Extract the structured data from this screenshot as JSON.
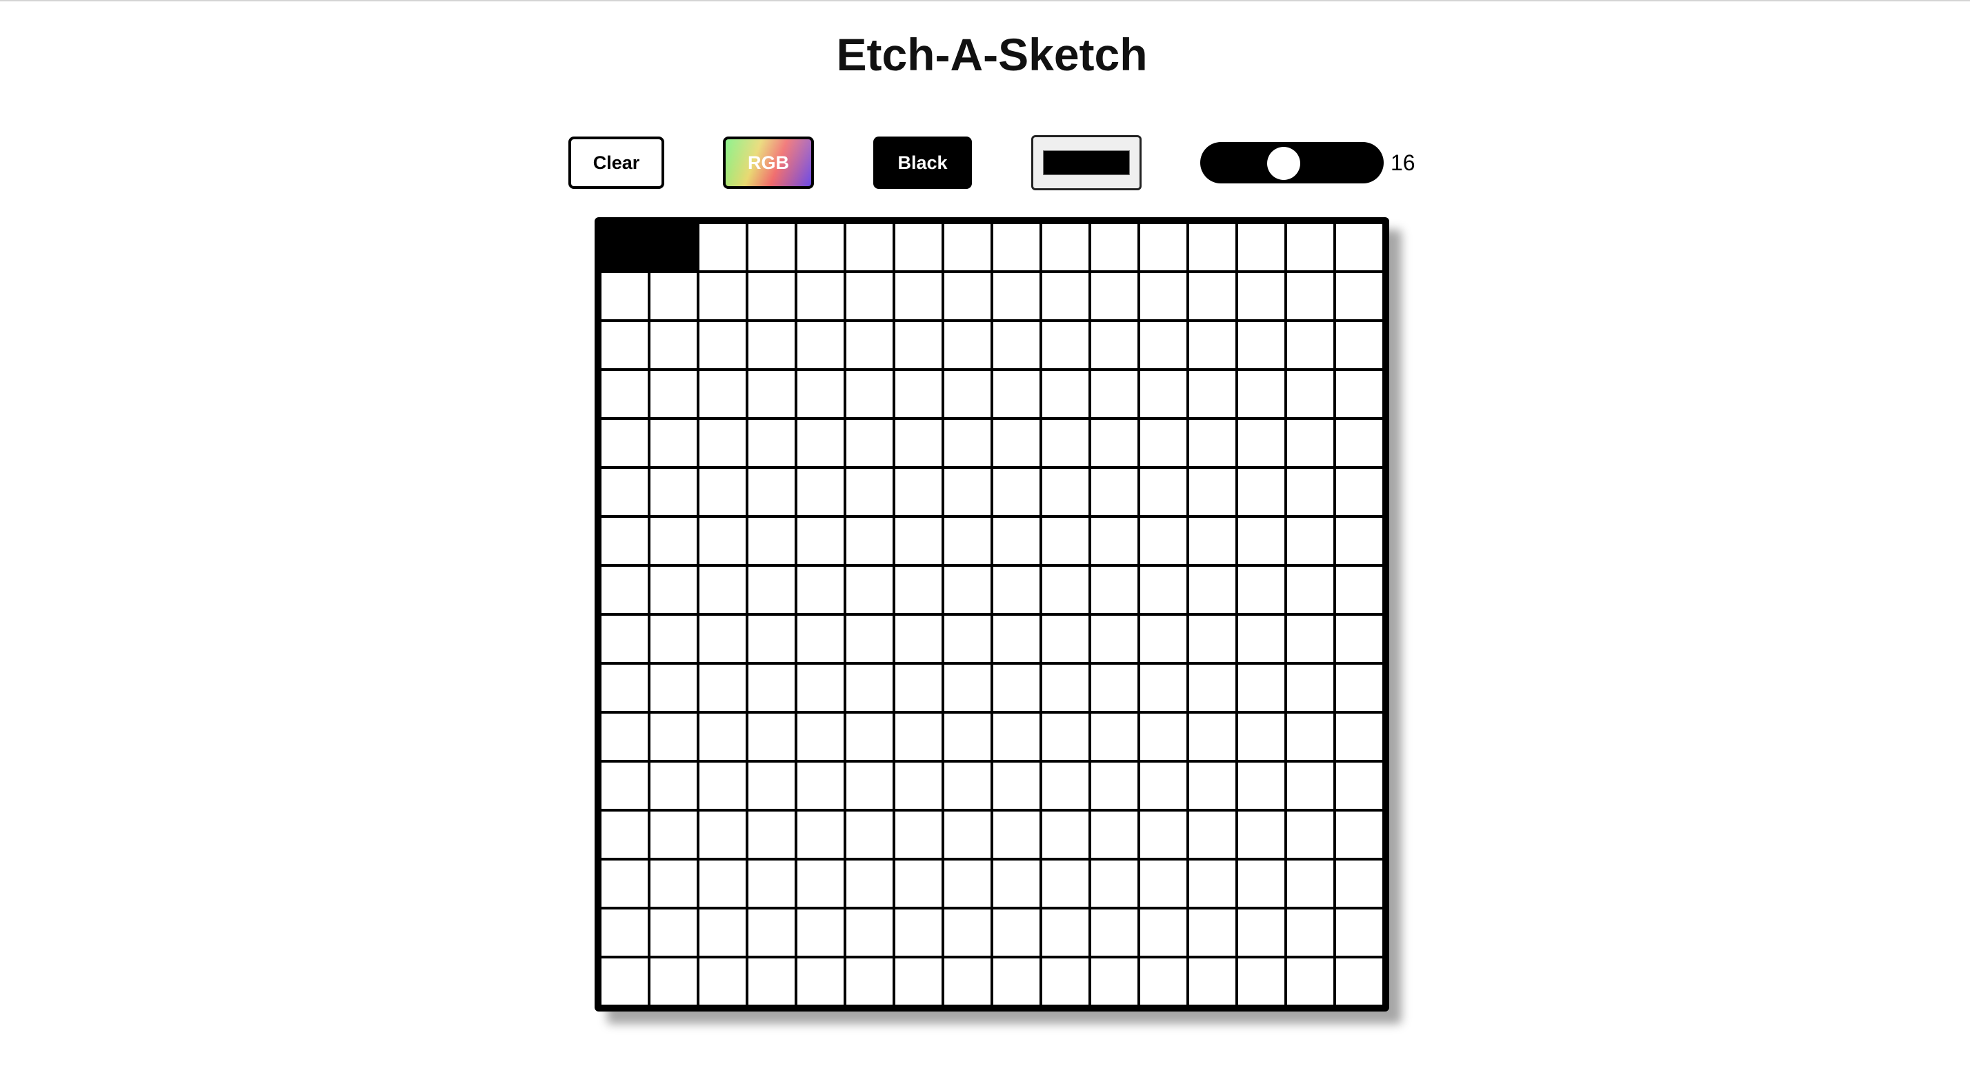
{
  "title": "Etch-A-Sketch",
  "controls": {
    "clear_label": "Clear",
    "rgb_label": "RGB",
    "black_label": "Black",
    "pen_color": "#000000",
    "grid_size": 16,
    "grid_size_label": "16",
    "slider_min": 1,
    "slider_max": 100
  },
  "grid": {
    "rows": 16,
    "cols": 16,
    "painted_cells": [
      [
        0,
        0
      ],
      [
        0,
        1
      ]
    ]
  },
  "colors": {
    "background": "#ffffff",
    "grid_line": "#000000",
    "cell": "#ffffff",
    "painted": "#000000"
  }
}
